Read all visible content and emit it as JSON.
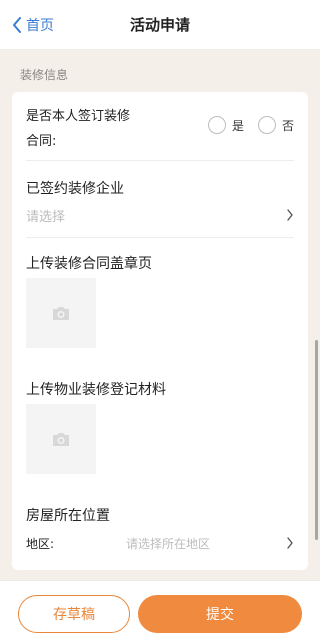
{
  "header": {
    "back_label": "首页",
    "title": "活动申请"
  },
  "section_label": "装修信息",
  "form": {
    "self_signed": {
      "label": "是否本人签订装修合同:",
      "options": [
        "是",
        "否"
      ]
    },
    "company": {
      "title": "已签约装修企业",
      "placeholder": "请选择"
    },
    "contract_upload": {
      "title": "上传装修合同盖章页"
    },
    "property_upload": {
      "title": "上传物业装修登记材料"
    },
    "location": {
      "title": "房屋所在位置",
      "region_label": "地区:",
      "region_placeholder": "请选择所在地区"
    }
  },
  "footer": {
    "draft_label": "存草稿",
    "submit_label": "提交"
  },
  "colors": {
    "accent": "#f08a3e",
    "link": "#3a7bd5",
    "background": "#f4efe9"
  }
}
